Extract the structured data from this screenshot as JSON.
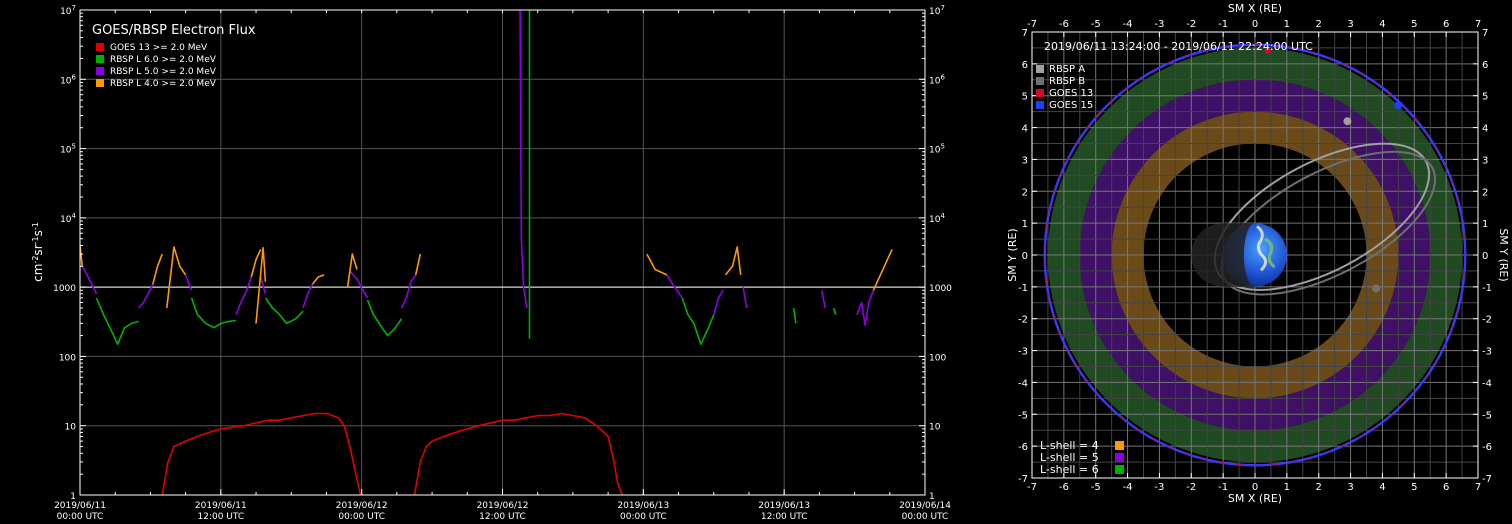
{
  "chart_data": [
    {
      "type": "line",
      "title": "GOES/RBSP Electron Flux",
      "ylabel_parts": {
        "a": "cm",
        "b": "-2",
        "c": "sr",
        "d": "-1",
        "e": "s",
        "f": "-1"
      },
      "yscale": "log",
      "ylim": [
        1,
        10000000
      ],
      "y_ticks": [
        {
          "v": 1,
          "label": "1"
        },
        {
          "v": 10,
          "label": "10"
        },
        {
          "v": 100,
          "label": "100"
        },
        {
          "v": 1000,
          "label": "1000"
        },
        {
          "v": 10000,
          "base": "10",
          "exp": "4"
        },
        {
          "v": 100000,
          "base": "10",
          "exp": "5"
        },
        {
          "v": 1000000,
          "base": "10",
          "exp": "6"
        },
        {
          "v": 10000000,
          "base": "10",
          "exp": "7"
        }
      ],
      "x_ticks": [
        {
          "date": "2019/06/11",
          "time": "00:00 UTC",
          "h": 0
        },
        {
          "date": "2019/06/11",
          "time": "12:00 UTC",
          "h": 12
        },
        {
          "date": "2019/06/12",
          "time": "00:00 UTC",
          "h": 24
        },
        {
          "date": "2019/06/12",
          "time": "12:00 UTC",
          "h": 36
        },
        {
          "date": "2019/06/13",
          "time": "00:00 UTC",
          "h": 48
        },
        {
          "date": "2019/06/13",
          "time": "12:00 UTC",
          "h": 60
        },
        {
          "date": "2019/06/14",
          "time": "00:00 UTC",
          "h": 72
        }
      ],
      "reference_line": 1000,
      "legend": [
        {
          "label": "GOES 13 >= 2.0 MeV",
          "color": "#e00000"
        },
        {
          "label": "RBSP L 6.0 >= 2.0 MeV",
          "color": "#00b000"
        },
        {
          "label": "RBSP L 5.0 >= 2.0 MeV",
          "color": "#8a00e0"
        },
        {
          "label": "RBSP L 4.0 >= 2.0 MeV",
          "color": "#ff9900"
        }
      ],
      "series": [
        {
          "name": "GOES 13 >= 2.0 MeV",
          "color": "#e00000",
          "segments": [
            [
              [
                7.0,
                1
              ],
              [
                7.5,
                3
              ],
              [
                8,
                5
              ],
              [
                9,
                6
              ],
              [
                10,
                7
              ],
              [
                11,
                8
              ],
              [
                12,
                9
              ],
              [
                13,
                9.5
              ],
              [
                14,
                10
              ],
              [
                15,
                11
              ],
              [
                16,
                12
              ],
              [
                17,
                12
              ],
              [
                18,
                13
              ],
              [
                19,
                14
              ],
              [
                20,
                15
              ],
              [
                21,
                15
              ],
              [
                22,
                13
              ],
              [
                22.5,
                10
              ],
              [
                23,
                5
              ],
              [
                23.5,
                2
              ],
              [
                23.9,
                1
              ]
            ],
            [
              [
                28.5,
                1
              ],
              [
                29,
                3
              ],
              [
                29.5,
                5
              ],
              [
                30,
                6
              ],
              [
                31,
                7
              ],
              [
                32,
                8
              ],
              [
                33,
                9
              ],
              [
                34,
                10
              ],
              [
                35,
                11
              ],
              [
                36,
                12
              ],
              [
                37,
                12
              ],
              [
                38,
                13
              ],
              [
                39,
                14
              ],
              [
                40,
                14
              ],
              [
                41,
                15
              ],
              [
                42,
                14
              ],
              [
                43,
                13
              ],
              [
                44,
                10
              ],
              [
                45,
                7
              ],
              [
                45.5,
                3
              ],
              [
                45.8,
                1.5
              ],
              [
                46.2,
                1
              ]
            ]
          ]
        },
        {
          "name": "RBSP L 6.0 >= 2.0 MeV",
          "color": "#00b000",
          "segments": [
            [
              [
                1.4,
                700
              ],
              [
                2,
                400
              ],
              [
                2.6,
                250
              ],
              [
                3.2,
                150
              ],
              [
                3.8,
                260
              ],
              [
                4.4,
                300
              ],
              [
                5,
                320
              ]
            ],
            [
              [
                9.5,
                700
              ],
              [
                10,
                400
              ],
              [
                10.7,
                300
              ],
              [
                11.4,
                260
              ],
              [
                12,
                300
              ],
              [
                12.7,
                320
              ],
              [
                13.3,
                330
              ]
            ],
            [
              [
                15.8,
                700
              ],
              [
                16.4,
                500
              ],
              [
                17,
                400
              ],
              [
                17.6,
                300
              ],
              [
                18.4,
                350
              ],
              [
                19,
                450
              ]
            ],
            [
              [
                24.5,
                650
              ],
              [
                25,
                400
              ],
              [
                25.6,
                280
              ],
              [
                26.2,
                200
              ],
              [
                26.8,
                250
              ],
              [
                27.4,
                350
              ]
            ],
            [
              [
                38.3,
                10000000
              ],
              [
                38.3,
                180
              ]
            ],
            [
              [
                51.3,
                700
              ],
              [
                51.8,
                400
              ],
              [
                52.3,
                300
              ],
              [
                52.9,
                150
              ],
              [
                53.5,
                250
              ],
              [
                54,
                400
              ]
            ],
            [
              [
                60.8,
                500
              ],
              [
                61,
                300
              ]
            ],
            [
              [
                64.2,
                500
              ],
              [
                64.4,
                400
              ]
            ]
          ]
        },
        {
          "name": "RBSP L 5.0 >= 2.0 MeV",
          "color": "#8a00e0",
          "segments": [
            [
              [
                0.2,
                2000
              ],
              [
                0.6,
                1500
              ],
              [
                1,
                1100
              ],
              [
                1.4,
                800
              ]
            ],
            [
              [
                5,
                500
              ],
              [
                5.4,
                600
              ],
              [
                5.8,
                800
              ],
              [
                6.2,
                1100
              ]
            ],
            [
              [
                9,
                1500
              ],
              [
                9.3,
                1100
              ],
              [
                9.5,
                900
              ]
            ],
            [
              [
                13.3,
                400
              ],
              [
                13.7,
                600
              ],
              [
                14.2,
                900
              ],
              [
                14.6,
                1400
              ]
            ],
            [
              [
                15.4,
                1400
              ],
              [
                15.8,
                800
              ]
            ],
            [
              [
                19,
                500
              ],
              [
                19.4,
                800
              ],
              [
                19.8,
                1100
              ]
            ],
            [
              [
                23,
                1700
              ],
              [
                23.6,
                1300
              ],
              [
                24.1,
                900
              ],
              [
                24.5,
                700
              ]
            ],
            [
              [
                27.4,
                500
              ],
              [
                27.8,
                700
              ],
              [
                28.2,
                1200
              ],
              [
                28.6,
                1500
              ]
            ],
            [
              [
                37.5,
                10000000
              ],
              [
                37.6,
                5000
              ],
              [
                37.8,
                1000
              ],
              [
                38.0,
                600
              ],
              [
                38.1,
                500
              ]
            ],
            [
              [
                50,
                1500
              ],
              [
                50.5,
                1100
              ],
              [
                51.3,
                700
              ]
            ],
            [
              [
                54,
                400
              ],
              [
                54.4,
                700
              ],
              [
                54.8,
                900
              ]
            ],
            [
              [
                56.5,
                1000
              ],
              [
                56.8,
                500
              ]
            ],
            [
              [
                63.2,
                900
              ],
              [
                63.5,
                500
              ]
            ],
            [
              [
                66.2,
                400
              ],
              [
                66.6,
                600
              ],
              [
                66.9,
                280
              ],
              [
                67.2,
                600
              ],
              [
                67.6,
                900
              ]
            ]
          ]
        },
        {
          "name": "RBSP L 4.0 >= 2.0 MeV",
          "color": "#ff9900",
          "segments": [
            [
              [
                0,
                4000
              ],
              [
                0.2,
                2000
              ]
            ],
            [
              [
                6.2,
                1100
              ],
              [
                6.6,
                2000
              ],
              [
                7.0,
                3000
              ]
            ],
            [
              [
                7.4,
                500
              ],
              [
                8,
                3800
              ],
              [
                8.5,
                2000
              ],
              [
                9,
                1500
              ]
            ],
            [
              [
                14.6,
                1400
              ],
              [
                15.0,
                2500
              ],
              [
                15.4,
                3500
              ]
            ],
            [
              [
                15,
                300
              ],
              [
                15.6,
                3700
              ],
              [
                15.8,
                1200
              ]
            ],
            [
              [
                19.8,
                1100
              ],
              [
                20.3,
                1400
              ],
              [
                20.8,
                1500
              ]
            ],
            [
              [
                22.8,
                1000
              ],
              [
                23.2,
                3000
              ],
              [
                23.6,
                1800
              ]
            ],
            [
              [
                28.6,
                1500
              ],
              [
                29,
                3000
              ]
            ],
            [
              [
                48.3,
                3000
              ],
              [
                49,
                1800
              ],
              [
                50,
                1500
              ]
            ],
            [
              [
                55,
                1500
              ],
              [
                55.6,
                2000
              ],
              [
                56,
                3800
              ],
              [
                56.3,
                1500
              ]
            ],
            [
              [
                67.6,
                900
              ],
              [
                68.2,
                1500
              ],
              [
                68.8,
                2500
              ],
              [
                69.2,
                3500
              ]
            ]
          ]
        }
      ]
    },
    {
      "type": "scatter",
      "subtitle": "2019/06/11 13:24:00 - 2019/06/11 22:24:00 UTC",
      "xlabel": "SM X (RE)",
      "ylabel": "SM Y (RE)",
      "xlim": [
        -7,
        7
      ],
      "ylim": [
        -7,
        7
      ],
      "ticks": [
        -7,
        -6,
        -5,
        -4,
        -3,
        -2,
        -1,
        0,
        1,
        2,
        3,
        4,
        5,
        6,
        7
      ],
      "tick_labels": [
        "-7",
        "-6",
        "-5",
        "-4",
        "-3",
        "-2",
        "-1",
        "0",
        "1",
        "2",
        "3",
        "4",
        "5",
        "6",
        "7"
      ],
      "grid": true,
      "legend": [
        {
          "label": "RBSP A",
          "color": "#a0a0a0"
        },
        {
          "label": "RBSP B",
          "color": "#707070"
        },
        {
          "label": "GOES 13",
          "color": "#e0002a"
        },
        {
          "label": "GOES 15",
          "color": "#2040ff"
        }
      ],
      "lshell_legend": [
        {
          "label": "L-shell = 4",
          "color": "#ff9900"
        },
        {
          "label": "L-shell = 5",
          "color": "#8a00e0"
        },
        {
          "label": "L-shell = 6",
          "color": "#00b000"
        }
      ],
      "bands": [
        {
          "rmin": 3.5,
          "rmax": 4.5,
          "color": "#6b4a1a"
        },
        {
          "rmin": 4.5,
          "rmax": 5.5,
          "color": "#3e1066"
        },
        {
          "rmin": 5.5,
          "rmax": 6.5,
          "color": "#1f4a22"
        }
      ],
      "geo_orbit_radius": 6.6,
      "earth_radius": 1,
      "orbit_a": {
        "cx": 2.1,
        "cy": 1.2,
        "a": 3.7,
        "b": 1.7,
        "angle": 28,
        "color": "#a0a0a0",
        "sat": [
          2.9,
          4.2
        ]
      },
      "orbit_b": {
        "cx": 2.3,
        "cy": 1.0,
        "a": 3.7,
        "b": 1.6,
        "angle": 28,
        "color": "#707070",
        "sat": [
          3.8,
          -1.05
        ]
      },
      "goes15_sat": [
        4.5,
        4.7
      ],
      "goes13_sat": [
        0.4,
        6.4
      ]
    }
  ]
}
